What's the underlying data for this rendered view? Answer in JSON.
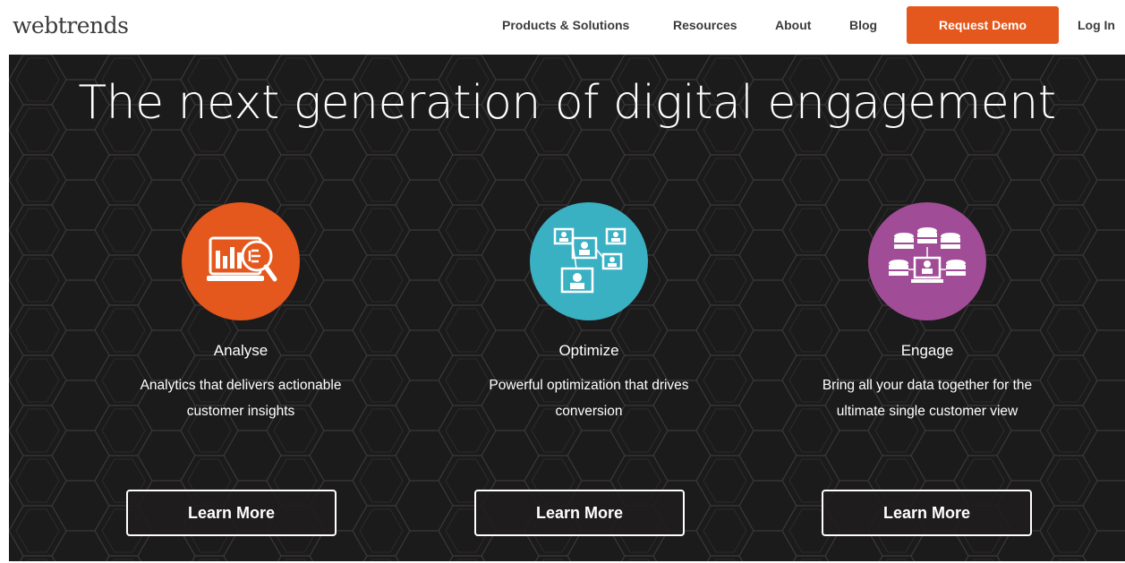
{
  "header": {
    "logo": "webtrends",
    "logo_mark": "·",
    "nav": [
      {
        "label": "Products & Solutions"
      },
      {
        "label": "Resources"
      },
      {
        "label": "About"
      },
      {
        "label": "Blog"
      }
    ],
    "request_demo": "Request Demo",
    "login": "Log In"
  },
  "hero": {
    "title": "The next generation of digital engagement",
    "features": [
      {
        "icon": "analytics-icon",
        "color": "#e4571d",
        "title": "Analyse",
        "desc_line1": "Analytics that delivers actionable",
        "desc_line2": "customer insights",
        "button": "Learn More"
      },
      {
        "icon": "optimize-network-icon",
        "color": "#3ab0c3",
        "title": "Optimize",
        "desc_line1": "Powerful optimization that drives",
        "desc_line2": "conversion",
        "button": "Learn More"
      },
      {
        "icon": "database-engage-icon",
        "color": "#a04c96",
        "title": "Engage",
        "desc_line1": "Bring all your data together for the",
        "desc_line2": "ultimate single customer view",
        "button": "Learn More"
      }
    ]
  },
  "colors": {
    "accent": "#e4571d",
    "hero_bg": "#1c1b1b"
  }
}
